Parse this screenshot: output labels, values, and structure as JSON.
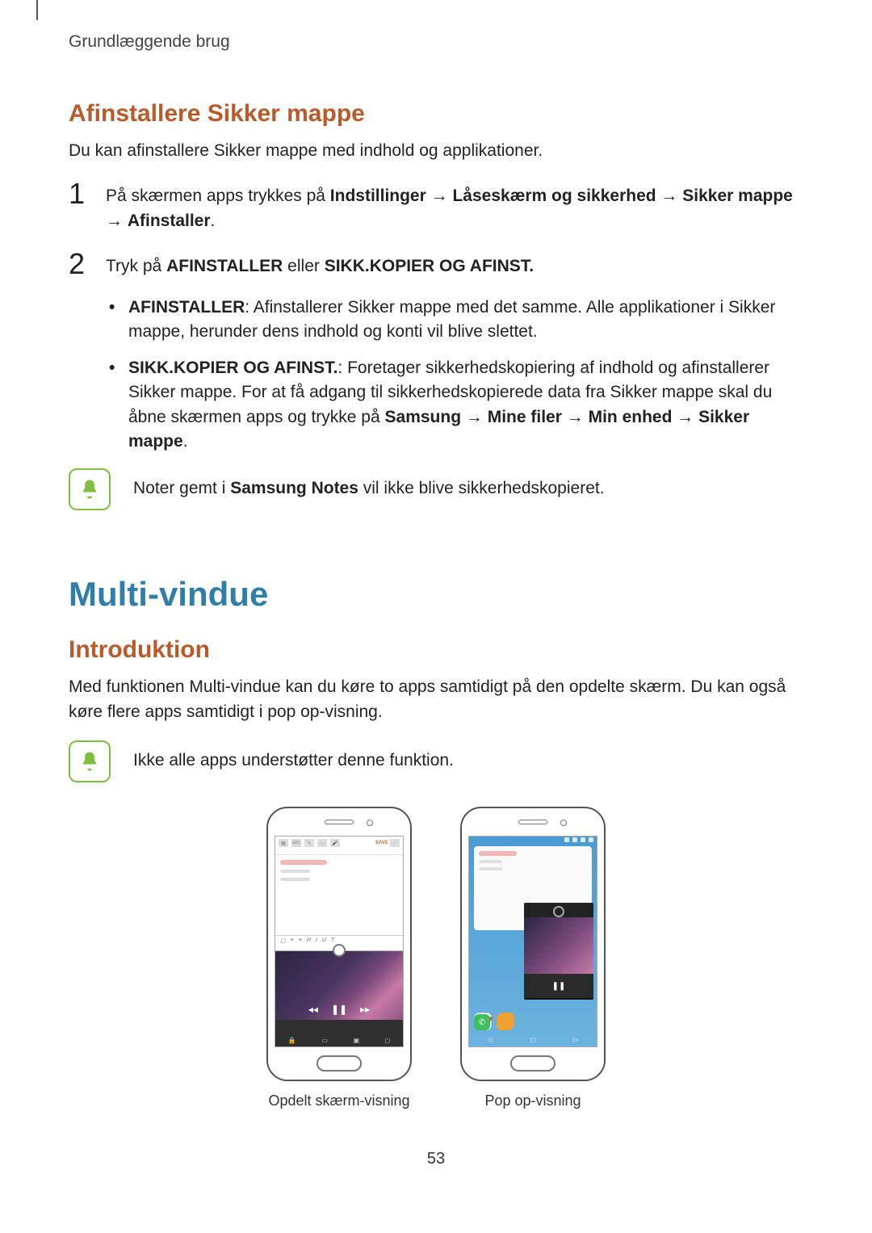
{
  "header": {
    "section": "Grundlæggende brug"
  },
  "uninstall": {
    "heading": "Afinstallere Sikker mappe",
    "intro": "Du kan afinstallere Sikker mappe med indhold og applikationer.",
    "step1": {
      "num": "1",
      "pre": "På skærmen apps trykkes på ",
      "path1": "Indstillinger",
      "arrow": " → ",
      "path2": "Låseskærm og sikkerhed",
      "path3": "Sikker mappe",
      "path4": "Afinstaller",
      "dot": "."
    },
    "step2": {
      "num": "2",
      "pre": "Tryk på ",
      "opt1": "AFINSTALLER",
      "mid": " eller ",
      "opt2": "SIKK.KOPIER OG AFINST."
    },
    "bullet1": {
      "label": "AFINSTALLER",
      "text": ": Afinstallerer Sikker mappe med det samme. Alle applikationer i Sikker mappe, herunder dens indhold og konti vil blive slettet."
    },
    "bullet2": {
      "label": "SIKK.KOPIER OG AFINST.",
      "text1": ": Foretager sikkerhedskopiering af indhold og afinstallerer Sikker mappe. For at få adgang til sikkerhedskopierede data fra Sikker mappe skal du åbne skærmen apps og trykke på ",
      "p1": "Samsung",
      "p2": "Mine filer",
      "p3": "Min enhed",
      "p4": "Sikker mappe",
      "dot": "."
    },
    "note": {
      "pre": "Noter gemt i ",
      "app": "Samsung Notes",
      "post": " vil ikke blive sikkerhedskopieret."
    }
  },
  "multi": {
    "heading": "Multi-vindue",
    "sub": "Introduktion",
    "intro": "Med funktionen Multi-vindue kan du køre to apps samtidigt på den opdelte skærm. Du kan også køre flere apps samtidigt i pop op-visning.",
    "note": "Ikke alle apps understøtter denne funktion.",
    "caption1": "Opdelt skærm-visning",
    "caption2": "Pop op-visning"
  },
  "pageNumber": "53"
}
